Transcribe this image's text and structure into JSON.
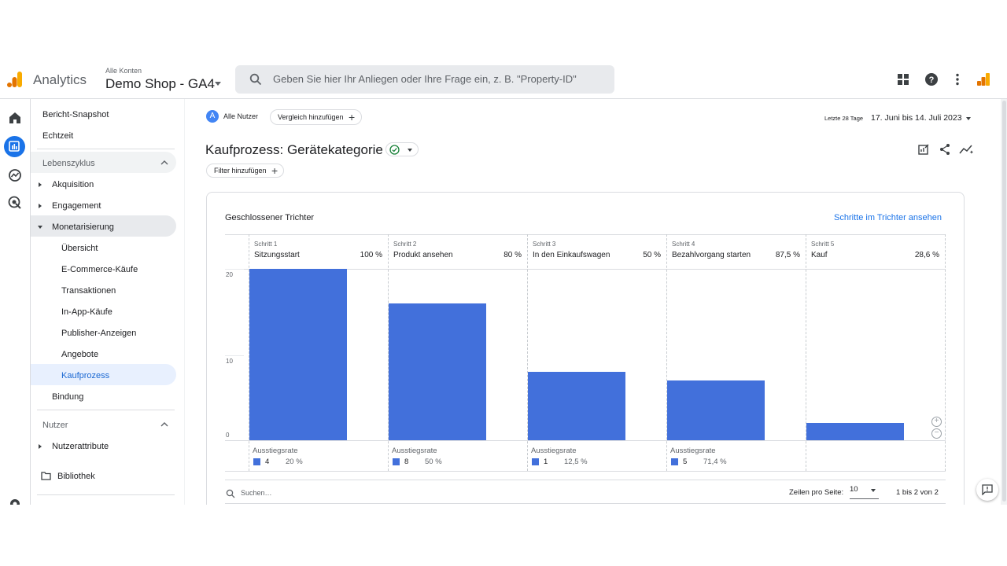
{
  "header": {
    "app_name": "Analytics",
    "account_label": "Alle Konten",
    "property_name": "Demo Shop - GA4",
    "search_placeholder": "Geben Sie hier Ihr Anliegen oder Ihre Frage ein, z. B. \"Property-ID\"",
    "icons": [
      "apps-grid-icon",
      "help-icon",
      "more-vert-icon",
      "analytics-logo-icon"
    ]
  },
  "rail": {
    "icons": [
      "home-icon",
      "reports-icon",
      "explore-icon",
      "advertising-icon",
      "settings-icon"
    ],
    "active": "reports-icon"
  },
  "sidebar": {
    "top_items": [
      "Bericht-Snapshot",
      "Echtzeit"
    ],
    "lifecycle_label": "Lebenszyklus",
    "lifecycle_items": {
      "acquisition": "Akquisition",
      "engagement": "Engagement",
      "monetization": "Monetarisierung"
    },
    "monetization_children": [
      "Übersicht",
      "E-Commerce-Käufe",
      "Transaktionen",
      "In-App-Käufe",
      "Publisher-Anzeigen",
      "Angebote",
      "Kaufprozess"
    ],
    "active_item": "Kaufprozess",
    "retention": "Bindung",
    "user_label": "Nutzer",
    "user_attributes": "Nutzerattribute",
    "library": "Bibliothek"
  },
  "main": {
    "segment_avatar": "A",
    "segment": "Alle Nutzer",
    "add_comparison": "Vergleich hinzufügen",
    "date_range_label": "Letzte 28 Tage",
    "date_range": "17. Juni bis 14. Juli 2023",
    "title": "Kaufprozess: Gerätekategorie",
    "add_filter": "Filter hinzufügen",
    "card_title": "Geschlossener Trichter",
    "card_link": "Schritte im Trichter ansehen",
    "drop_label": "Ausstiegsrate",
    "search_placeholder": "Suchen…",
    "rows_per_page_label": "Zeilen pro Seite:",
    "rows_per_page": "10",
    "pagination": "1 bis 2 von 2"
  },
  "colors": {
    "accent": "#1a73e8",
    "bar": "#4270db"
  },
  "chart_data": {
    "type": "bar",
    "categories": [
      "Sitzungsstart",
      "Produkt ansehen",
      "In den Einkaufswagen",
      "Bezahlvorgang starten",
      "Kauf"
    ],
    "step_labels": [
      "Schritt 1",
      "Schritt 2",
      "Schritt 3",
      "Schritt 4",
      "Schritt 5"
    ],
    "step_rates": [
      "100 %",
      "80 %",
      "50 %",
      "87,5 %",
      "28,6 %"
    ],
    "values": [
      20,
      16,
      8,
      7,
      2
    ],
    "dropoffs": [
      {
        "count": "4",
        "rate": "20 %"
      },
      {
        "count": "8",
        "rate": "50 %"
      },
      {
        "count": "1",
        "rate": "12,5 %"
      },
      {
        "count": "5",
        "rate": "71,4 %"
      }
    ],
    "yticks": [
      "20",
      "10",
      "0"
    ],
    "ylim": [
      0,
      20
    ]
  }
}
